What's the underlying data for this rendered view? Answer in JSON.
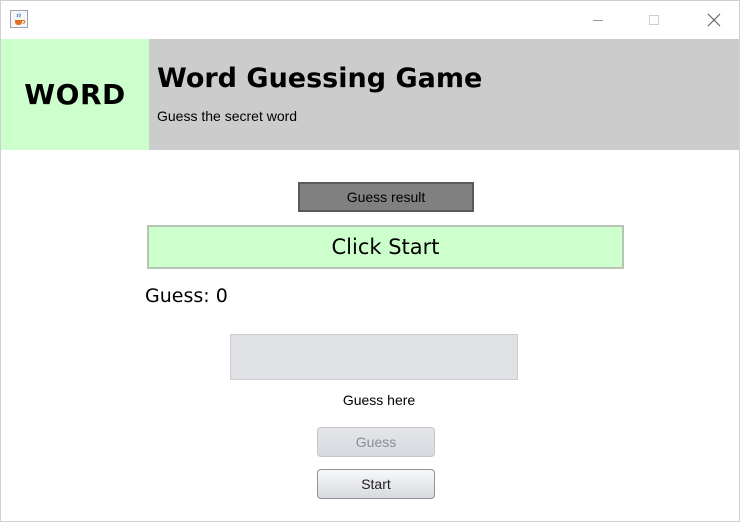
{
  "window": {
    "icon": "java-cup-icon",
    "controls": [
      "minimize-icon",
      "maximize-icon",
      "close-icon"
    ]
  },
  "header": {
    "logo_text": "WORD",
    "title": "Word Guessing Game",
    "subtitle": "Guess the secret word",
    "logo_bg": "#ccffcc",
    "band_bg": "#cccccc"
  },
  "game": {
    "result_label": "Guess result",
    "result_text": "Click Start",
    "guess_count": "Guess: 0",
    "input_value": "",
    "input_caption": "Guess here",
    "guess_button": "Guess",
    "start_button": "Start",
    "result_bg": "#ccffcc",
    "label_bg": "#808080"
  }
}
